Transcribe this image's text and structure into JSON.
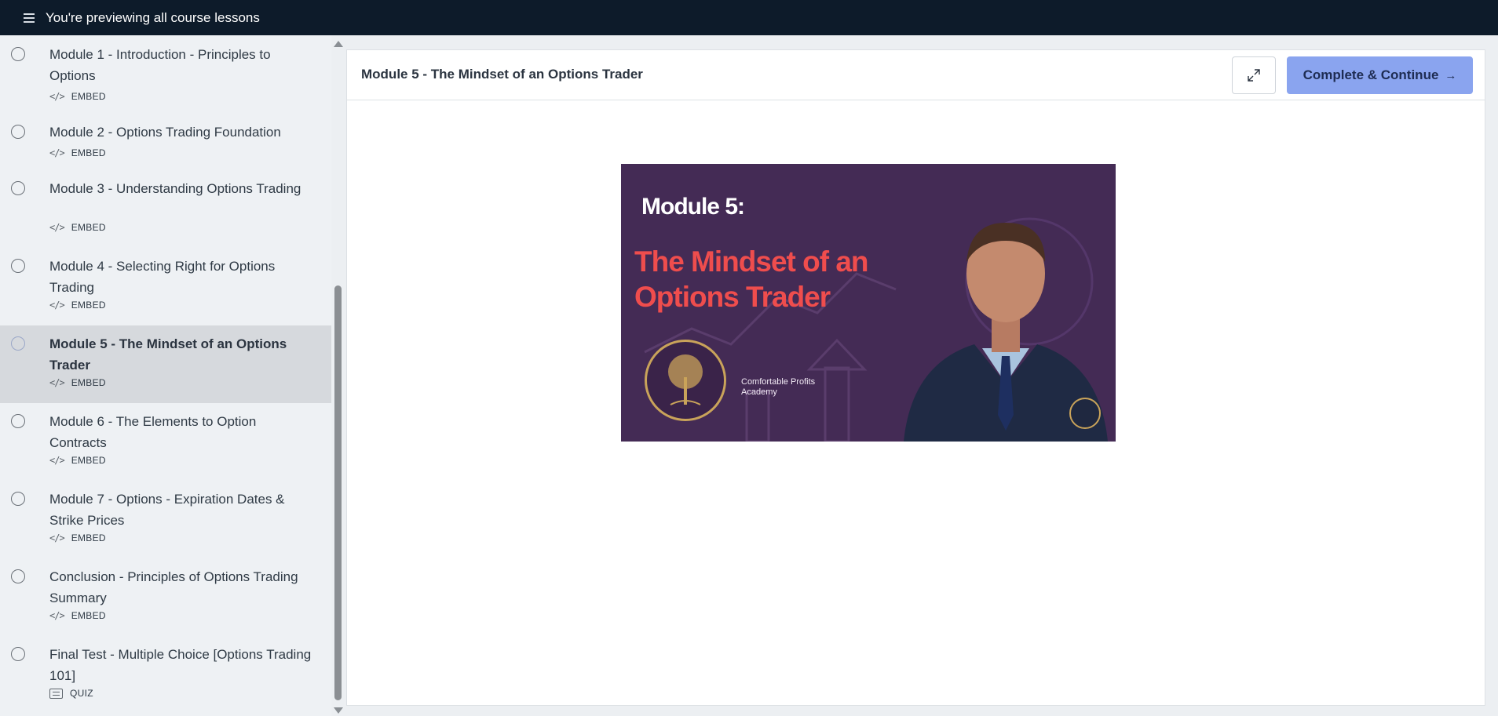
{
  "topbar": {
    "menu_icon": "hamburger-menu-icon",
    "preview_text": "You're previewing all course lessons"
  },
  "sidebar": {
    "lessons": [
      {
        "title": "Module 1 - Introduction - Principles to Options",
        "type": "EMBED",
        "icon": "code-icon",
        "active": false
      },
      {
        "title": "Module 2 - Options Trading Foundation",
        "type": "EMBED",
        "icon": "code-icon",
        "active": false
      },
      {
        "title": "Module 3 - Understanding Options Trading",
        "type": "EMBED",
        "icon": "code-icon",
        "active": false
      },
      {
        "title": "Module 4 - Selecting Right for Options Trading",
        "type": "EMBED",
        "icon": "code-icon",
        "active": false
      },
      {
        "title": "Module 5 - The Mindset of an Options Trader",
        "type": "EMBED",
        "icon": "code-icon",
        "active": true
      },
      {
        "title": "Module 6 - The Elements to Option Contracts",
        "type": "EMBED",
        "icon": "code-icon",
        "active": false
      },
      {
        "title": "Module 7 - Options - Expiration Dates & Strike Prices",
        "type": "EMBED",
        "icon": "code-icon",
        "active": false
      },
      {
        "title": "Conclusion - Principles of Options Trading Summary",
        "type": "EMBED",
        "icon": "code-icon",
        "active": false
      },
      {
        "title": "Final Test - Multiple Choice [Options Trading 101]",
        "type": "QUIZ",
        "icon": "quiz-icon",
        "active": false
      }
    ]
  },
  "content": {
    "lesson_title": "Module 5 - The Mindset of an Options Trader",
    "expand_icon": "expand-icon",
    "continue_label": "Complete & Continue",
    "continue_icon": "arrow-right-icon",
    "accent_color": "#8aa4ef"
  },
  "video": {
    "module_label": "Module 5:",
    "title": "The Mindset of an Options Trader",
    "academy_name": "Comfortable Profits Academy",
    "title_color": "#ef4d4d",
    "background_color": "#442b55"
  }
}
